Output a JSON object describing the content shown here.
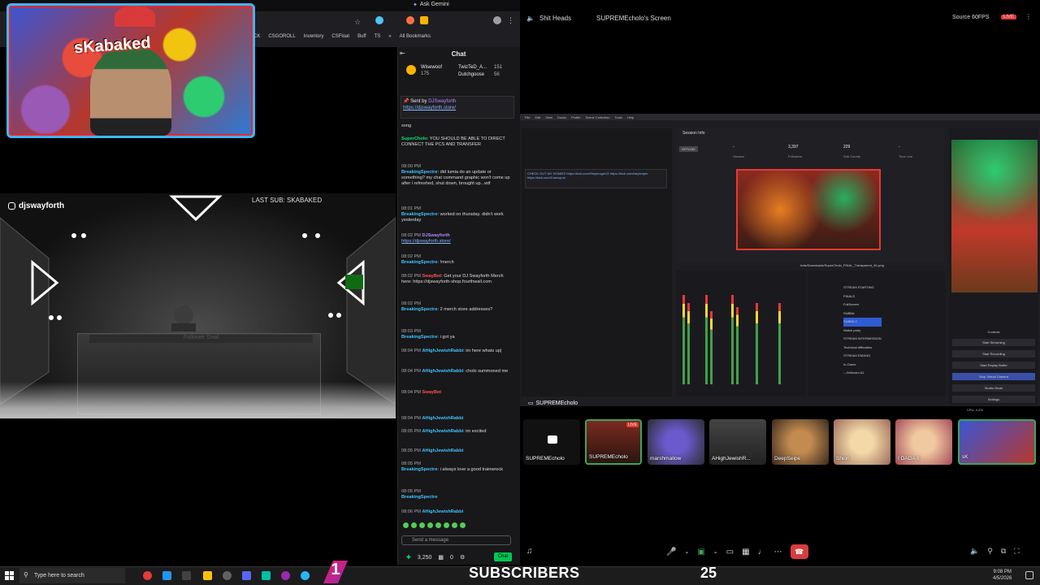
{
  "browser": {
    "tab_title": "Ask Gemini",
    "bookmarks": [
      "TRACK",
      "CSGOROLL",
      "Inventory",
      "CSFloat",
      "Buff",
      "TS",
      "All Bookmarks"
    ]
  },
  "overlay": {
    "webcam_logo": "sKabaked",
    "streamer_handle": "djswayforth",
    "last_sub": "LAST SUB: SKABAKED",
    "board_label": "Follower Goal"
  },
  "chat": {
    "title": "Chat",
    "leaders": [
      {
        "name": "Wisewoof",
        "points": "175"
      },
      {
        "name": "TwizTeD_A...",
        "points": "151"
      },
      {
        "name": "Dutchgoose",
        "points": "56"
      }
    ],
    "pinned": {
      "by": "Sent by",
      "user": "DJSwayforth",
      "link": "https://djswayforth.store/"
    },
    "messages": [
      {
        "time": "",
        "user": "",
        "text": "song"
      },
      {
        "time": "",
        "user": "SuperCholo",
        "text": "YOU SHOULD BE ABLE TO DIRECT CONNECT THE PCS AND TRANSFER"
      },
      {
        "time": "08:00 PM",
        "user": "BreakingSpectre",
        "text": "did lumia do an update or something? my chat command graphic won't come up after i refreshed, shut down, brought up...wtf"
      },
      {
        "time": "08:01 PM",
        "user": "BreakingSpectre",
        "text": "worked on thursday. didn't work yesterday"
      },
      {
        "time": "08:02 PM",
        "user": "DJSwayforth",
        "text": "https://djswayforth.store/"
      },
      {
        "time": "08:02 PM",
        "user": "BreakingSpectre",
        "text": "!merch"
      },
      {
        "time": "08:02 PM",
        "user": "SwayBot",
        "text": "Get your DJ Swayforth Merch here: https://djswayforth-shop.fourthwall.com"
      },
      {
        "time": "08:02 PM",
        "user": "BreakingSpectre",
        "text": "2 merch store addresses?"
      },
      {
        "time": "08:03 PM",
        "user": "BreakingSpectre",
        "text": "i got ya"
      },
      {
        "time": "08:04 PM",
        "user": "AHighJewishRabbi",
        "text": "im here whats up|"
      },
      {
        "time": "08:04 PM",
        "user": "AHighJewishRabbi",
        "text": "cholo summoned me"
      },
      {
        "time": "08:04 PM",
        "user": "SwayBot",
        "text": ""
      },
      {
        "time": "08:04 PM",
        "user": "AHighJewishRabbi",
        "text": ""
      },
      {
        "time": "08:05 PM",
        "user": "AHighJewishRabbi",
        "text": "im excited"
      },
      {
        "time": "08:05 PM",
        "user": "AHighJewishRabbi",
        "text": ""
      },
      {
        "time": "08:05 PM",
        "user": "BreakingSpectre",
        "text": "i always love a good trainwreck"
      },
      {
        "time": "08:05 PM",
        "user": "BreakingSpectre",
        "text": ""
      },
      {
        "time": "08:06 PM",
        "user": "AHighJewishRabbi",
        "text": ""
      }
    ],
    "input_placeholder": "Send a message",
    "points": "3,250",
    "badge_count": "0",
    "chat_button": "Chat"
  },
  "discord": {
    "server": "Shit Heads",
    "screen_title": "SUPREMEcholo's Screen",
    "source_label": "Source 60FPS",
    "live_label": "LIVE",
    "screen_share_user": "SUPREMEcholo",
    "participants": [
      "SUPREMEcholo",
      "SUPREMEcholo",
      "marshmallow",
      "AHighJewishR...",
      "DeepSeipe",
      "Shiori",
      "I DADA II",
      "sK"
    ],
    "participant_live_label": "LIVE"
  },
  "obs": {
    "menu": [
      "File",
      "Edit",
      "View",
      "Docks",
      "Profile",
      "Scene Collection",
      "Tools",
      "Help"
    ],
    "session_title": "Session Info",
    "status_badge": "OFFLINE",
    "stats": [
      {
        "label": "Viewers",
        "value": "-"
      },
      {
        "label": "Followers",
        "value": "3,397"
      },
      {
        "label": "Sub Counts",
        "value": "229"
      },
      {
        "label": "Time Live",
        "value": "-"
      }
    ],
    "pinned_chat": "CHECK OUT MY HOMIEZ https://kick.com/Slayeroger22 https://kick.com/lazysniper https://kick.com/Carnsyum",
    "scenes": [
      "STREAM STARTING",
      "FINALS",
      "FullScreen",
      "SUBBA",
      "SUBBA 2",
      "Watch party",
      "STREAM INTERMISSION",
      "Technical difficulties",
      "STREAM ENDING",
      "In-Game",
      "---Webcam A1"
    ],
    "controls": [
      "Controls",
      "Start Streaming",
      "Start Recording",
      "Start Replay Buffer",
      "Stop Virtual Camera",
      "Studio Mode",
      "Settings"
    ],
    "image_file": "hots/Downloads/SuperCholo_FINAL_Transparent_4K.png",
    "stats_bar": "CPU: 4.2%"
  },
  "taskbar": {
    "search_placeholder": "Type here to search",
    "subscribers_label": "SUBSCRIBERS",
    "subscribers_count": "25",
    "time": "9:08 PM",
    "date": "4/5/2026"
  }
}
